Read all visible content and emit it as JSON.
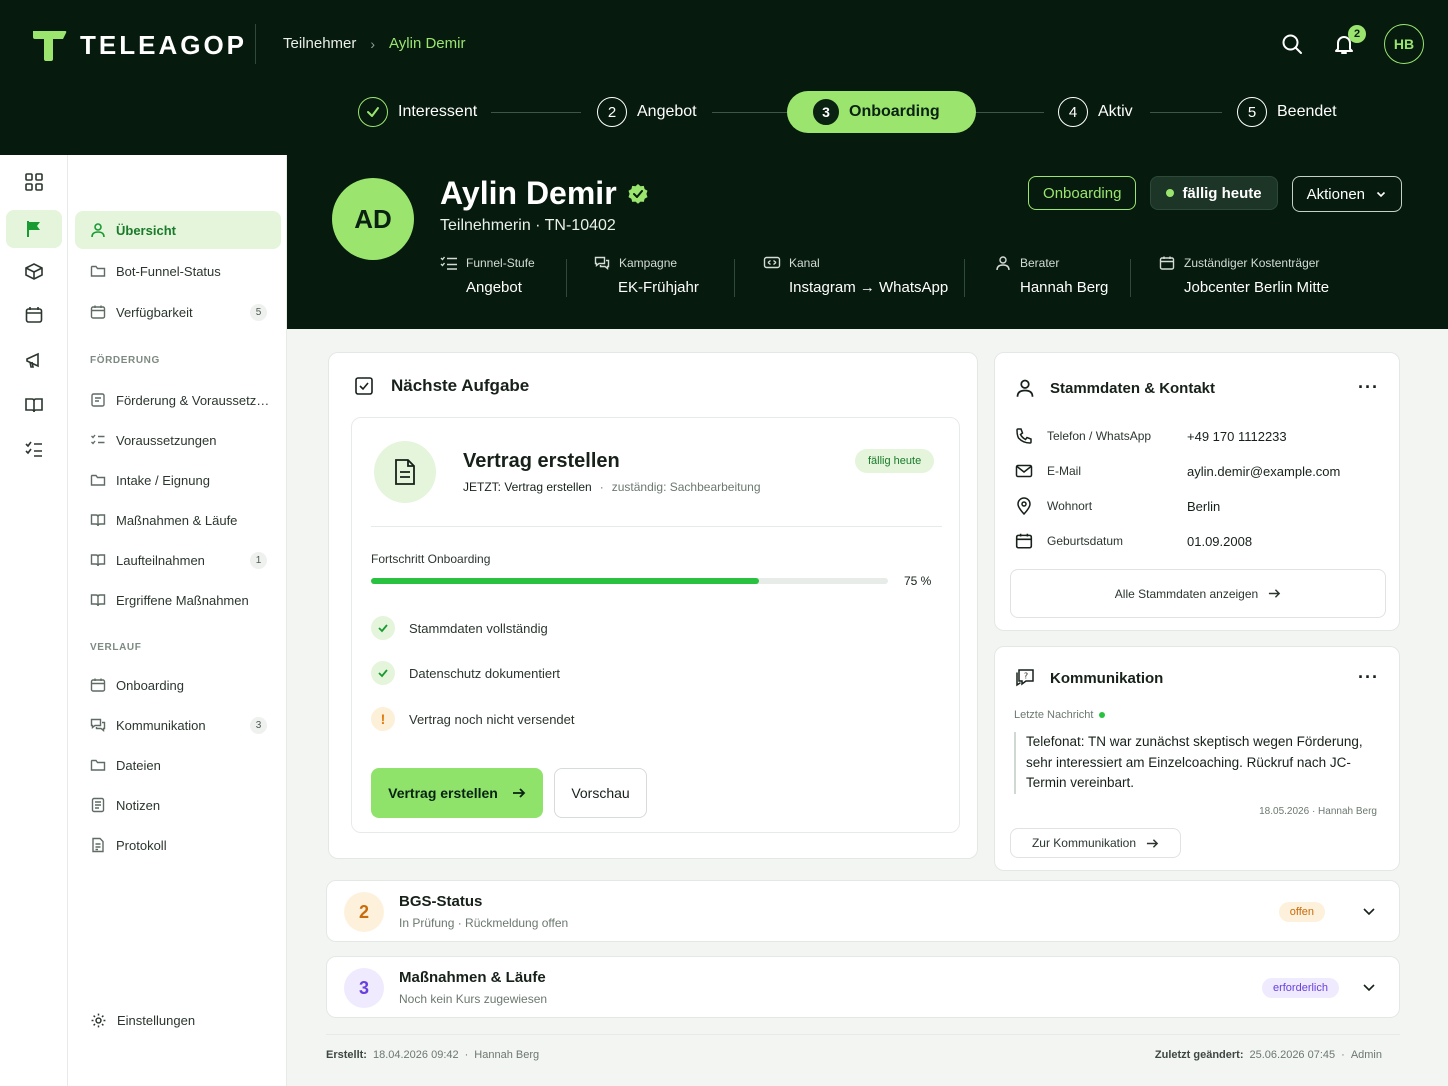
{
  "brand": {
    "name": "TELEAGOP",
    "accent": "#9be56f",
    "dark": "#061a0e"
  },
  "breadcrumb": {
    "root": "Teilnehmer",
    "current": "Aylin Demir"
  },
  "header": {
    "notifications": "2",
    "user_initials": "HB"
  },
  "steps": [
    {
      "num": "✓",
      "label": "Interessent",
      "state": "done"
    },
    {
      "num": "2",
      "label": "Angebot",
      "state": "open"
    },
    {
      "num": "3",
      "label": "Onboarding",
      "state": "active"
    },
    {
      "num": "4",
      "label": "Aktiv",
      "state": "open"
    },
    {
      "num": "5",
      "label": "Beendet",
      "state": "open"
    }
  ],
  "nav": {
    "items": [
      {
        "label": "Übersicht",
        "icon": "user-icon",
        "active": true
      },
      {
        "label": "Bot-Funnel-Status",
        "icon": "folder-icon"
      },
      {
        "label": "Verfügbarkeit",
        "icon": "calendar-icon",
        "badge": "5"
      }
    ],
    "section_foerderung": "FÖRDERUNG",
    "foerderung": [
      {
        "label": "Förderung & Voraussetzungen",
        "icon": "document-icon"
      },
      {
        "label": "Voraussetzungen",
        "icon": "checklist-icon"
      },
      {
        "label": "Intake / Eignung",
        "icon": "folder-icon"
      },
      {
        "label": "Maßnahmen & Läufe",
        "icon": "book-icon"
      },
      {
        "label": "Laufteilnahmen",
        "icon": "book-icon",
        "badge": "1"
      },
      {
        "label": "Ergriffene Maßnahmen",
        "icon": "book-icon"
      }
    ],
    "section_verlauf": "VERLAUF",
    "verlauf": [
      {
        "label": "Onboarding",
        "icon": "calendar-icon"
      },
      {
        "label": "Kommunikation",
        "icon": "chat-icon",
        "badge": "3"
      },
      {
        "label": "Dateien",
        "icon": "folder-icon"
      },
      {
        "label": "Notizen",
        "icon": "note-icon"
      },
      {
        "label": "Protokoll",
        "icon": "protocol-icon"
      }
    ],
    "settings": "Einstellungen"
  },
  "profile": {
    "initials": "AD",
    "name": "Aylin Demir",
    "subtitle": "Teilnehmerin · TN-10402",
    "tag_status": "Onboarding",
    "tag_due": "fällig heute",
    "actions": "Aktionen",
    "meta": [
      {
        "label": "Funnel-Stufe",
        "value": "Angebot",
        "icon": "list-icon"
      },
      {
        "label": "Kampagne",
        "value": "EK-Frühjahr",
        "icon": "chat-icon"
      },
      {
        "label": "Kanal",
        "value": "Instagram → WhatsApp",
        "icon": "channel-icon"
      },
      {
        "label": "Berater",
        "value": "Hannah Berg",
        "icon": "user-icon"
      },
      {
        "label": "Zuständiger Kostenträger",
        "value": "Jobcenter Berlin Mitte",
        "icon": "calendar-icon"
      }
    ]
  },
  "task": {
    "section_title": "Nächste Aufgabe",
    "title": "Vertrag erstellen",
    "now": "JETZT: Vertrag erstellen",
    "sep": "·",
    "owner": "zuständig: Sachbearbeitung",
    "due": "fällig heute",
    "progress_label": "Fortschritt Onboarding",
    "progress": 75,
    "progress_text": "75 %",
    "checks": [
      {
        "label": "Stammdaten vollständig",
        "state": "ok"
      },
      {
        "label": "Datenschutz dokumentiert",
        "state": "ok"
      },
      {
        "label": "Vertrag noch nicht versendet",
        "state": "warn",
        "mark": "!"
      }
    ],
    "primary": "Vertrag erstellen",
    "secondary": "Vorschau"
  },
  "contact": {
    "title": "Stammdaten & Kontakt",
    "rows": [
      {
        "label": "Telefon / WhatsApp",
        "value": "+49 170 1112233",
        "icon": "phone-icon"
      },
      {
        "label": "E-Mail",
        "value": "aylin.demir@example.com",
        "icon": "mail-icon"
      },
      {
        "label": "Wohnort",
        "value": "Berlin",
        "icon": "location-icon"
      },
      {
        "label": "Geburtsdatum",
        "value": "01.09.2008",
        "icon": "calendar-icon"
      }
    ],
    "all": "Alle Stammdaten anzeigen"
  },
  "comm": {
    "title": "Kommunikation",
    "last_label": "Letzte Nachricht",
    "message": "Telefonat: TN war zunächst skeptisch wegen Förderung, sehr interessiert am Einzelcoaching. Rückruf nach JC-Termin vereinbart.",
    "meta": "18.05.2026 · Hannah Berg",
    "link": "Zur Kommunikation"
  },
  "rows": [
    {
      "num": "2",
      "title": "BGS-Status",
      "sub": "In Prüfung · Rückmeldung offen",
      "pill": "offen",
      "color": "#c96b0a",
      "bg": "#fdf1dc"
    },
    {
      "num": "3",
      "title": "Maßnahmen & Läufe",
      "sub": "Noch kein Kurs zugewiesen",
      "pill": "erforderlich",
      "color": "#6a3fe0",
      "bg": "#efeafd"
    }
  ],
  "footer": {
    "created_label": "Erstellt:",
    "created": "18.04.2026 09:42",
    "created_by": "Hannah Berg",
    "dot": "·",
    "changed_label": "Zuletzt geändert:",
    "changed": "25.06.2026 07:45",
    "changed_by": "Admin"
  }
}
